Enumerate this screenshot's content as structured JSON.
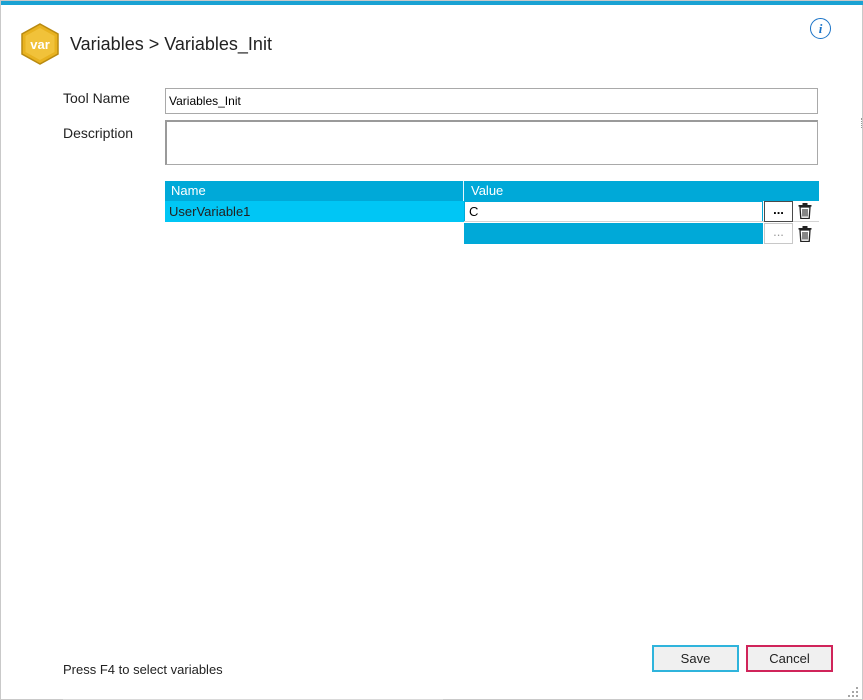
{
  "header": {
    "logo_text": "var",
    "logo_color": "#e8b21f",
    "title": "Variables > Variables_Init",
    "info_icon": "info-icon"
  },
  "form": {
    "tool_name_label": "Tool Name",
    "tool_name_value": "Variables_Init",
    "description_label": "Description",
    "description_value": ""
  },
  "grid": {
    "columns": [
      "Name",
      "Value"
    ],
    "rows": [
      {
        "name": "UserVariable1",
        "value": "C",
        "ellipsis": "...",
        "delete_icon": "trash-icon"
      }
    ],
    "new_row": {
      "ellipsis": "...",
      "delete_icon": "trash-icon"
    },
    "header_color": "#00a9d8",
    "selected_color": "#00c6f5"
  },
  "footer": {
    "status_text": "Press F4 to select variables",
    "save_label": "Save",
    "cancel_label": "Cancel",
    "save_border_color": "#2fb4dc",
    "cancel_border_color": "#d0245a"
  }
}
